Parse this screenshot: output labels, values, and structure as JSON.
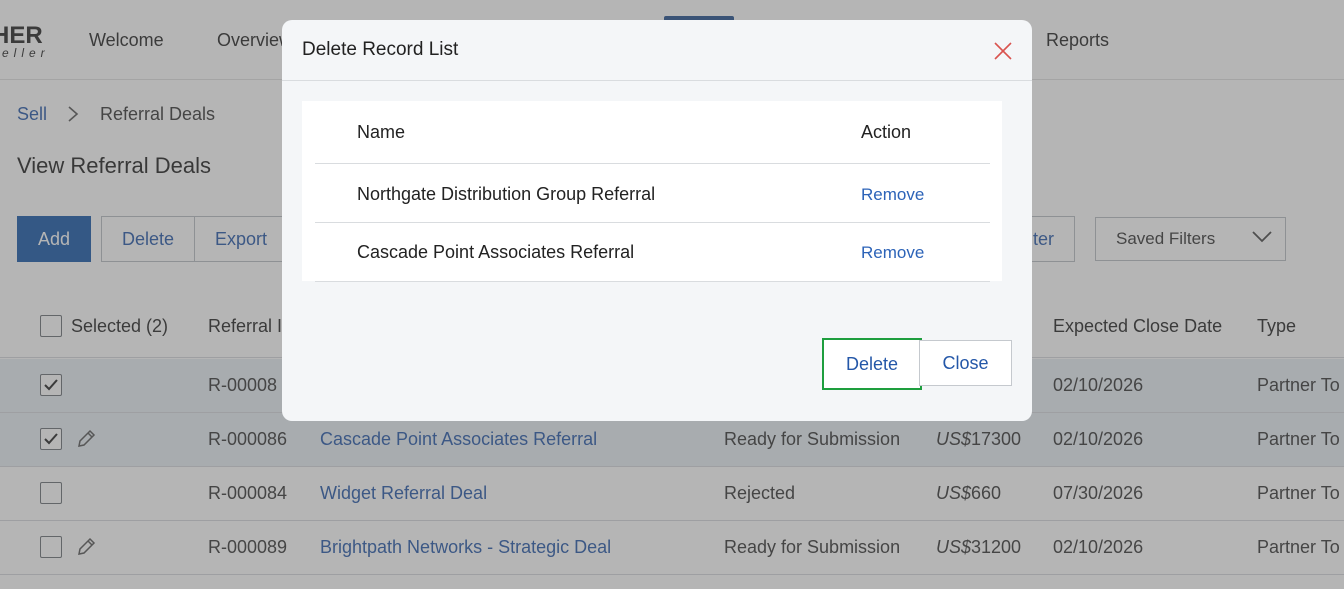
{
  "nav": {
    "logo_main": "HER",
    "logo_sub": "eller",
    "items": [
      "Welcome",
      "Overview",
      "Reports"
    ]
  },
  "breadcrumb": {
    "parent": "Sell",
    "current": "Referral Deals"
  },
  "page": {
    "title": "View Referral Deals"
  },
  "toolbar": {
    "add_label": "Add",
    "delete_label": "Delete",
    "export_label": "Export",
    "filter_label": "ter",
    "saved_filters_label": "Saved Filters"
  },
  "table": {
    "headers": {
      "selected": "Selected (2)",
      "referral_id": "Referral I",
      "expected_close_date": "Expected Close Date",
      "type": "Type"
    },
    "rows": [
      {
        "checked": true,
        "editable": false,
        "id": "R-00008",
        "name": "",
        "status": "",
        "currency": "",
        "amount": "",
        "close_date": "02/10/2026",
        "type": "Partner To"
      },
      {
        "checked": true,
        "editable": true,
        "id": "R-000086",
        "name": "Cascade Point Associates Referral",
        "status": "Ready for Submission",
        "currency": "US$",
        "amount": "17300",
        "close_date": "02/10/2026",
        "type": "Partner To"
      },
      {
        "checked": false,
        "editable": false,
        "id": "R-000084",
        "name": "Widget Referral Deal",
        "status": "Rejected",
        "currency": "US$",
        "amount": "660",
        "close_date": "07/30/2026",
        "type": "Partner To"
      },
      {
        "checked": false,
        "editable": true,
        "id": "R-000089",
        "name": "Brightpath Networks - Strategic Deal",
        "status": "Ready for Submission",
        "currency": "US$",
        "amount": "31200",
        "close_date": "02/10/2026",
        "type": "Partner To"
      }
    ]
  },
  "modal": {
    "title": "Delete Record List",
    "col_name": "Name",
    "col_action": "Action",
    "rows": [
      {
        "name": "Northgate Distribution Group Referral",
        "action": "Remove"
      },
      {
        "name": "Cascade Point Associates Referral",
        "action": "Remove"
      }
    ],
    "delete_label": "Delete",
    "close_label": "Close"
  },
  "colors": {
    "primary": "#1556a8",
    "link": "#2457a8",
    "focus_ring": "#1e9e3e",
    "close_icon": "#d9534f",
    "selected_row": "#e7eef5"
  }
}
